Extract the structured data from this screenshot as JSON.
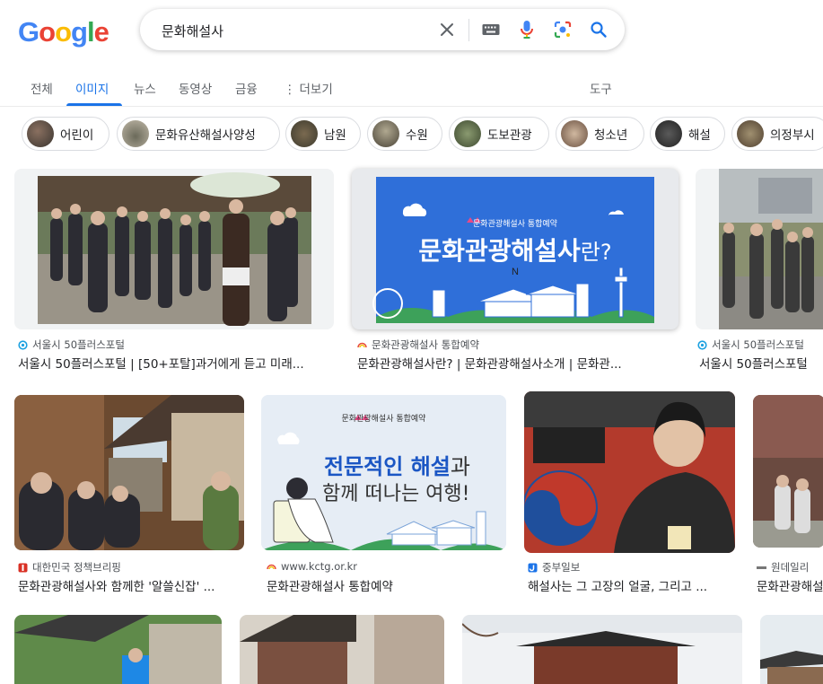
{
  "logo": {
    "letters": [
      "G",
      "o",
      "o",
      "g",
      "l",
      "e"
    ]
  },
  "search": {
    "query": "문화해설사"
  },
  "tabs": [
    "전체",
    "이미지",
    "뉴스",
    "동영상",
    "금융",
    "더보기"
  ],
  "tools_label": "도구",
  "chips": [
    "어린이",
    "문화유산해설사양성",
    "남원",
    "수원",
    "도보관광",
    "청소년",
    "해설",
    "의정부시"
  ],
  "poster1": {
    "brand": "문화관광해설사 통합예약",
    "headline": "문화관광해설사",
    "suffix": "란?"
  },
  "poster2": {
    "brand": "문화관광해설사 통합예약",
    "line1a": "전문적인 ",
    "line1b": "해설",
    "line1c": "과",
    "line2": "함께 떠나는 여행!"
  },
  "results": [
    {
      "source": "서울시 50플러스포털",
      "title": "서울시 50플러스포털 | [50+포탈]과거에게 듣고 미래..."
    },
    {
      "source": "문화관광해설사 통합예약",
      "title": "문화관광해설사란? | 문화관광해설사소개 | 문화관..."
    },
    {
      "source": "서울시 50플러스포털",
      "title": "서울시 50플러스포털"
    },
    {
      "source": "대한민국 정책브리핑",
      "title": "문화관광해설사와 함께한 '알쓸신잡' ..."
    },
    {
      "source": "www.kctg.or.kr",
      "title": "문화관광해설사 통합예약"
    },
    {
      "source": "중부일보",
      "title": "해설사는 그 고장의 얼굴, 그리고 ..."
    },
    {
      "source": "원데일리",
      "title": "문화관광해설"
    }
  ],
  "colors": {
    "accent": "#1a73e8",
    "poster_blue": "#2f6fd9"
  }
}
